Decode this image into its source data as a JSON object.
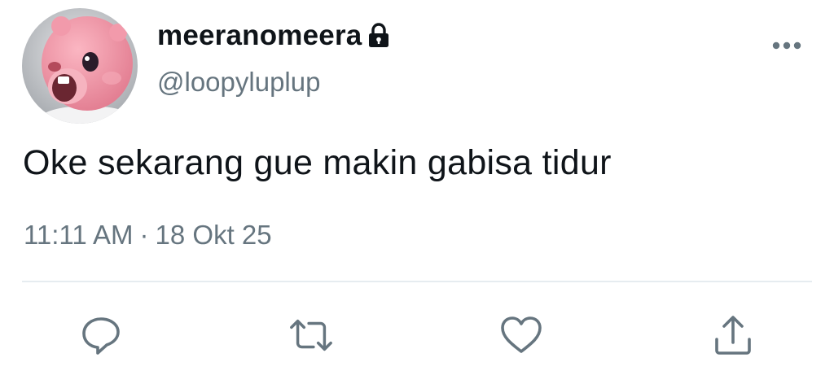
{
  "author": {
    "display_name": "meeranomeera",
    "handle": "@loopyluplup",
    "protected_icon": "lock-icon",
    "avatar_icon": "pink-beaver-character-avatar"
  },
  "tweet": {
    "text": "Oke sekarang gue makin gabisa tidur",
    "time": "11:11 AM",
    "separator": "·",
    "date": "18 Okt 25"
  },
  "actions": [
    {
      "name": "reply",
      "icon": "reply-icon"
    },
    {
      "name": "retweet",
      "icon": "retweet-icon"
    },
    {
      "name": "like",
      "icon": "heart-icon"
    },
    {
      "name": "share",
      "icon": "share-icon"
    }
  ],
  "colors": {
    "text_primary": "#0f1419",
    "text_secondary": "#66757f",
    "icon": "#66757f",
    "divider": "#e6ecf0",
    "avatar_pink": "#f08fa0"
  }
}
